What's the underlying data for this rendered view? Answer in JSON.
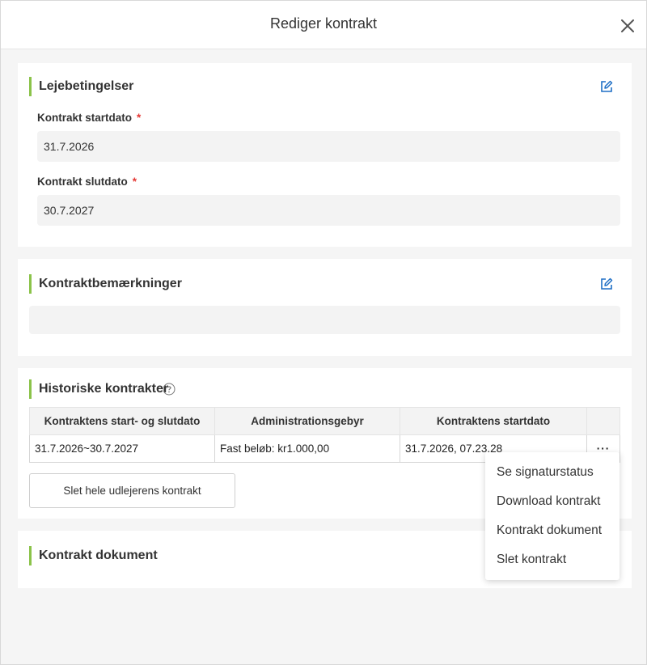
{
  "modal": {
    "title": "Rediger kontrakt"
  },
  "lease_terms": {
    "title": "Lejebetingelser",
    "start_label": "Kontrakt startdato",
    "start_value": "31.7.2026",
    "end_label": "Kontrakt slutdato",
    "end_value": "30.7.2027",
    "required_mark": "*"
  },
  "remarks": {
    "title": "Kontraktbemærkninger",
    "value": ""
  },
  "history": {
    "title": "Historiske kontrakter",
    "columns": [
      "Kontraktens start- og slutdato",
      "Administrationsgebyr",
      "Kontraktens startdato"
    ],
    "rows": [
      {
        "period": "31.7.2026~30.7.2027",
        "fee": "Fast beløb: kr1.000,00",
        "start": "31.7.2026, 07.23.28",
        "more": "···"
      }
    ],
    "delete_all_label": "Slet hele udlejerens kontrakt"
  },
  "document": {
    "title": "Kontrakt dokument"
  },
  "row_menu": {
    "items": [
      "Se signaturstatus",
      "Download kontrakt",
      "Kontrakt dokument",
      "Slet kontrakt"
    ]
  },
  "colors": {
    "accent_bar": "#8bc34a",
    "edit_icon": "#1f6fc5",
    "required": "#e53935"
  }
}
